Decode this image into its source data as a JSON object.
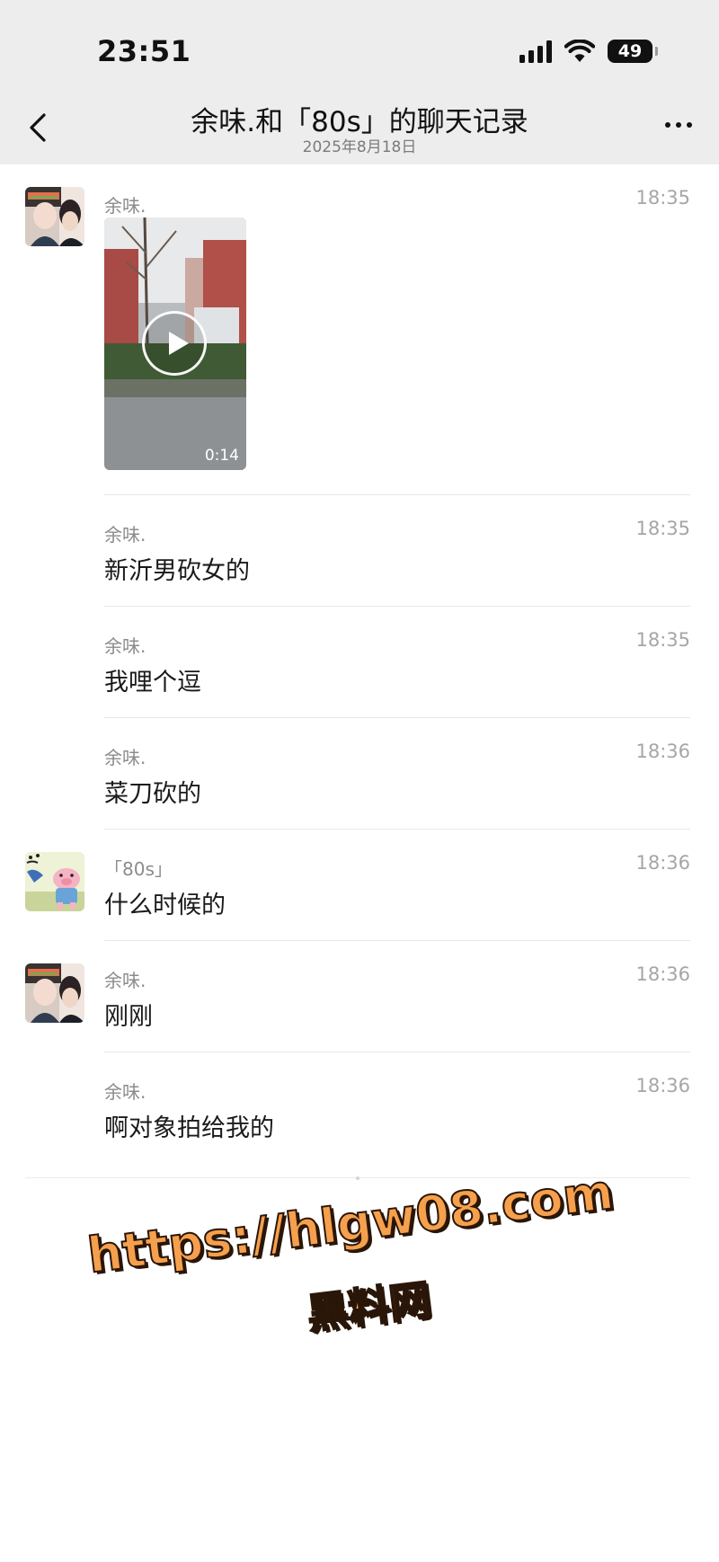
{
  "status_bar": {
    "time": "23:51",
    "battery": "49",
    "icons": [
      "cellular-signal-icon",
      "wifi-icon",
      "battery-icon"
    ]
  },
  "header": {
    "title": "余味.和「80s」的聊天记录",
    "date": "2025年8月18日",
    "back_icon": "chevron-left-icon",
    "more_icon": "ellipsis-icon"
  },
  "messages": [
    {
      "sender": "余味.",
      "time": "18:35",
      "type": "video",
      "video_duration": "0:14"
    },
    {
      "sender": "余味.",
      "time": "18:35",
      "text": "新沂男砍女的"
    },
    {
      "sender": "余味.",
      "time": "18:35",
      "text": "我哩个逗"
    },
    {
      "sender": "余味.",
      "time": "18:36",
      "text": "菜刀砍的"
    },
    {
      "sender": "「80s」",
      "time": "18:36",
      "text": "什么时候的"
    },
    {
      "sender": "余味.",
      "time": "18:36",
      "text": "刚刚"
    },
    {
      "sender": "余味.",
      "time": "18:36",
      "text": "啊对象拍给我的"
    }
  ],
  "watermark": {
    "url": "https://hlgw08.com",
    "label": "黑料网"
  },
  "colors": {
    "header_bg": "#ededed",
    "watermark": "#f6a04d"
  }
}
